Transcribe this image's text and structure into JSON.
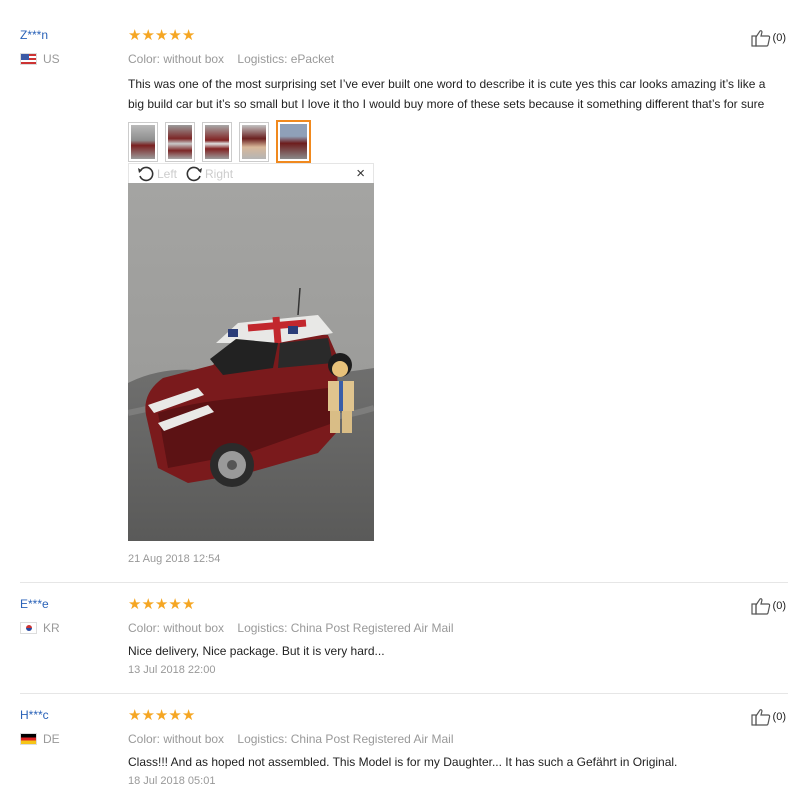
{
  "reviews": [
    {
      "buyer": "Z***n",
      "country": "US",
      "rating": 5,
      "color_label": "Color: without box",
      "logistics_label": "Logistics: ePacket",
      "text": "This was one of the most surprising set I’ve ever built one word to describe it is cute yes this car looks amazing it’s like a big build car but it’s so small but I love it tho I would buy more of these sets because it something different that’s for sure",
      "date": "21 Aug 2018 12:54",
      "helpful": "(0)",
      "image_count": 5
    },
    {
      "buyer": "E***e",
      "country": "KR",
      "rating": 5,
      "color_label": "Color: without box",
      "logistics_label": "Logistics: China Post Registered Air Mail",
      "text": "Nice delivery, Nice package. But it is very hard...",
      "date": "13 Jul 2018 22:00",
      "helpful": "(0)"
    },
    {
      "buyer": "H***c",
      "country": "DE",
      "rating": 5,
      "color_label": "Color: without box",
      "logistics_label": "Logistics: China Post Registered Air Mail",
      "text": "Class!!! And as hoped not assembled. This Model is for my Daughter... It has such a Gefährt in Original.",
      "date": "18 Jul 2018 05:01",
      "helpful": "(0)"
    }
  ],
  "viewer": {
    "rotate_left": "Left",
    "rotate_right": "Right",
    "close": "×"
  },
  "colors": {
    "star": "#f5a623",
    "buyer_link": "#2a62b8",
    "active_thumb": "#f0891e"
  }
}
